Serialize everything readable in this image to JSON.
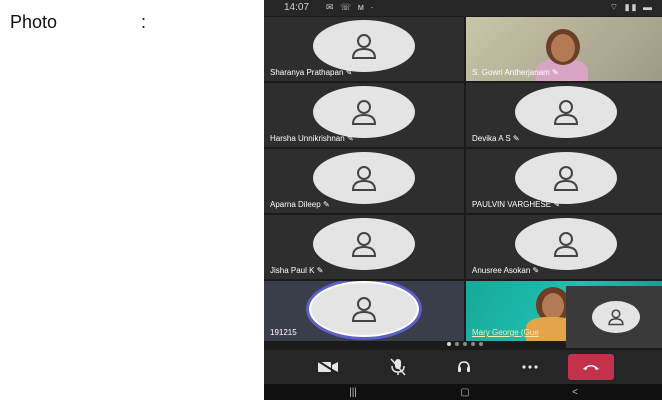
{
  "document": {
    "label": "Photo",
    "colon": ":"
  },
  "status_bar": {
    "time": "14:07",
    "left_icons": "✉ ☏ ᴍ ·",
    "right_icons": "⌔ ▮▮ ▬"
  },
  "participants": [
    {
      "name": "Sharanya Prathapan",
      "type": "avatar"
    },
    {
      "name": "S. Gowri Antherjanam",
      "type": "video"
    },
    {
      "name": "Harsha Unnikrishnan",
      "type": "avatar"
    },
    {
      "name": "Devika A S",
      "type": "avatar"
    },
    {
      "name": "Aparna Dileep",
      "type": "avatar"
    },
    {
      "name": "PAULVIN VARGHESE",
      "type": "avatar"
    },
    {
      "name": "Jisha Paul K",
      "type": "avatar"
    },
    {
      "name": "Anusree Asokan",
      "type": "avatar"
    },
    {
      "name": "191215",
      "type": "avatar",
      "selected": true
    },
    {
      "name": "Mary George (Gue",
      "type": "video"
    }
  ],
  "mic_muted_icon": "mic-off-icon",
  "page_indicator": {
    "count": 5,
    "active_index": 0
  },
  "call_controls": [
    "video-camera-icon",
    "mic-off-icon",
    "speaker-icon",
    "more-icon",
    "hang-up-icon"
  ],
  "android_nav": {
    "recents": "|||",
    "home": "▢",
    "back": "<"
  },
  "colors": {
    "background": "#1b1b1b",
    "tile": "#2e2e2e",
    "avatar": "#e4e4e4",
    "accent": "#5b5fc7",
    "hangup": "#c4314b"
  }
}
